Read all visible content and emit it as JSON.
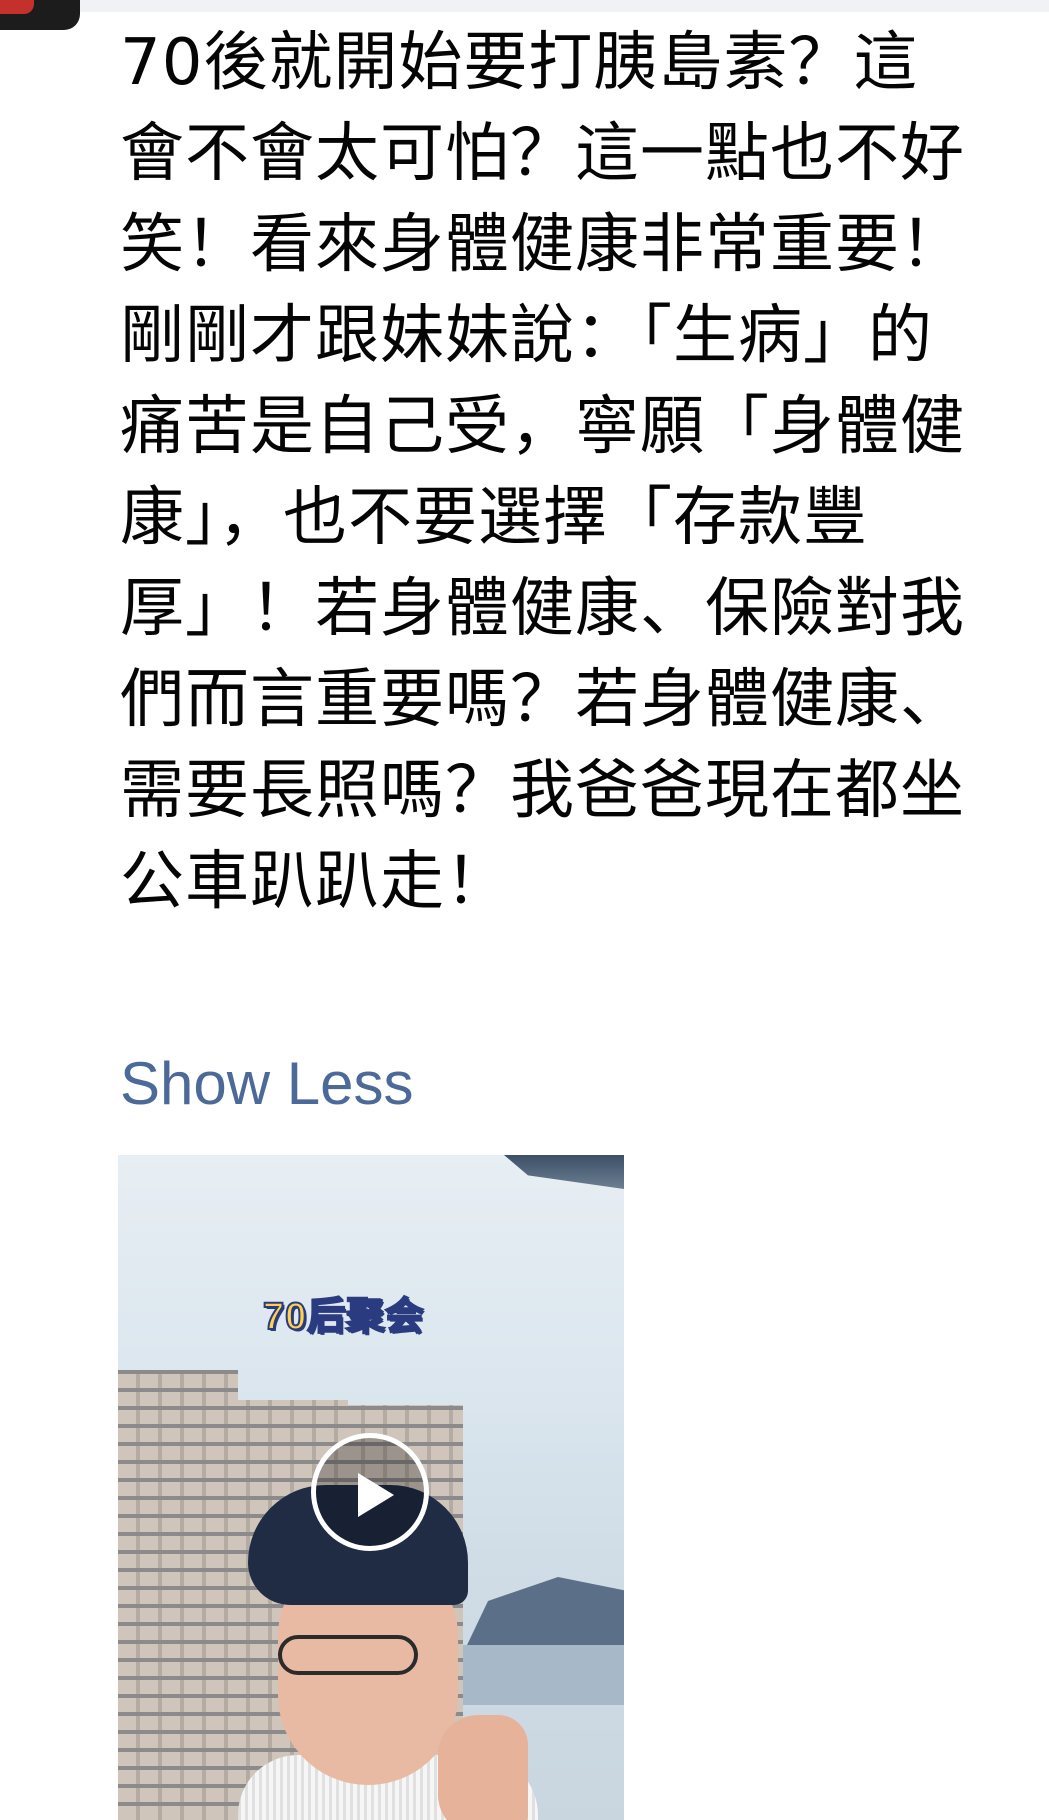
{
  "post": {
    "text": "70後就開始要打胰島素？這會不會太可怕？這一點也不好笑！看來身體健康非常重要！剛剛才跟妹妹說：「生病」的痛苦是自己受，寧願「身體健康」，也不要選擇「存款豐厚」！若身體健康、保險對我們而言重要嗎？若身體健康、需要長照嗎？我爸爸現在都坐公車趴趴走！",
    "show_less_label": "Show Less"
  },
  "video": {
    "caption": "70后聚会",
    "play_icon": "play-icon"
  },
  "colors": {
    "link": "#4b6a99",
    "text": "#050505",
    "caption_fill": "#ffd24a",
    "caption_stroke": "#2a3b80"
  }
}
